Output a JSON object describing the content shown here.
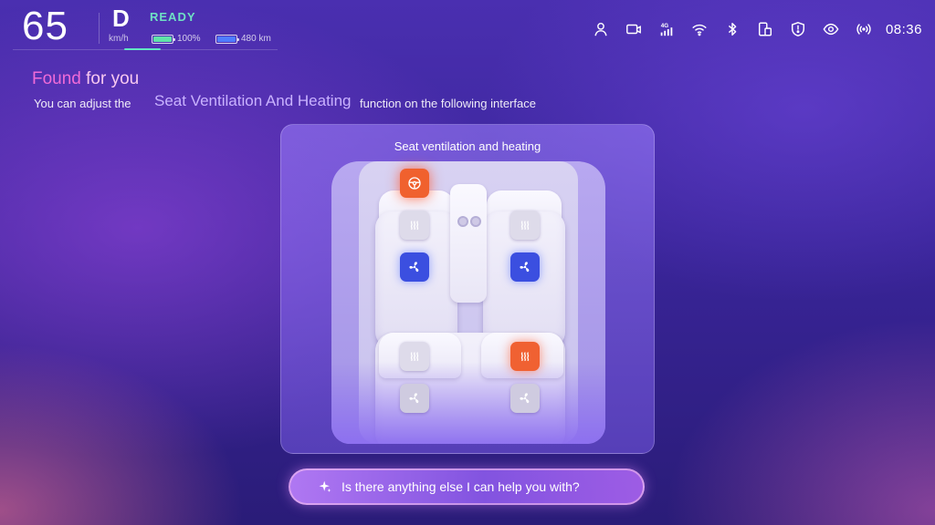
{
  "status": {
    "speed": "65",
    "speed_unit": "km/h",
    "gear": "D",
    "ready": "READY",
    "battery_percent": "100%",
    "battery_level": 1.0,
    "range": "480 km",
    "network": "4G",
    "time": "08:36",
    "icons": [
      "user-icon",
      "camera-icon",
      "network-4g-icon",
      "wifi-icon",
      "bluetooth-icon",
      "phone-link-icon",
      "shield-icon",
      "eye-icon",
      "broadcast-icon"
    ]
  },
  "assistant": {
    "found_part1": "Found",
    "found_part2": "for you",
    "sub_prefix": "You can adjust the",
    "sub_feature": "Seat Ventilation And Heating",
    "sub_suffix": "function on the following interface"
  },
  "card": {
    "title": "Seat ventilation and heating",
    "steering_heat": "on",
    "seats": {
      "front_left": {
        "heating": "off",
        "ventilation": "on"
      },
      "front_right": {
        "heating": "off",
        "ventilation": "on"
      },
      "rear_left": {
        "heating": "off",
        "ventilation": "off"
      },
      "rear_right": {
        "heating": "on",
        "ventilation": "off"
      }
    }
  },
  "prompt": {
    "text": "Is there anything else I can help you with?"
  },
  "colors": {
    "accent_teal": "#6fe0c4",
    "heat_on": "#f06132",
    "fan_on": "#3b4fe0",
    "title_pink": "#f06bd8"
  }
}
